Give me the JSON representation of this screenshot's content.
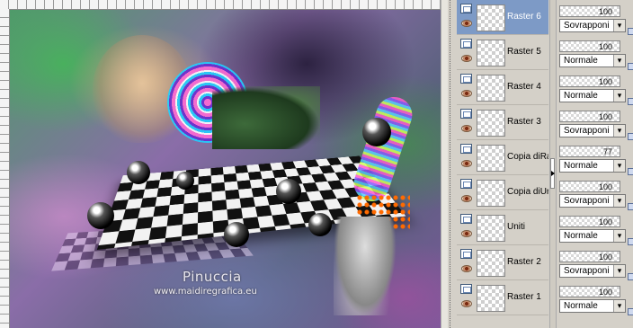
{
  "watermark": {
    "author": "Pinuccia",
    "site": "www.maidiregrafica.eu"
  },
  "layers": [
    {
      "name": "Raster 6",
      "selected": true
    },
    {
      "name": "Raster 5",
      "selected": false
    },
    {
      "name": "Raster 4",
      "selected": false
    },
    {
      "name": "Raster 3",
      "selected": false
    },
    {
      "name": "Copia diRa",
      "selected": false
    },
    {
      "name": "Copia diUr",
      "selected": false
    },
    {
      "name": "Uniti",
      "selected": false
    },
    {
      "name": "Raster 2",
      "selected": false
    },
    {
      "name": "Raster 1",
      "selected": false
    }
  ],
  "properties": [
    {
      "opacity": "100",
      "blend": "Sovrapponi"
    },
    {
      "opacity": "100",
      "blend": "Normale"
    },
    {
      "opacity": "100",
      "blend": "Normale"
    },
    {
      "opacity": "100",
      "blend": "Sovrapponi"
    },
    {
      "opacity": "77",
      "blend": "Normale"
    },
    {
      "opacity": "100",
      "blend": "Sovrapponi"
    },
    {
      "opacity": "100",
      "blend": "Normale"
    },
    {
      "opacity": "100",
      "blend": "Sovrapponi"
    },
    {
      "opacity": "100",
      "blend": "Normale"
    }
  ],
  "colors": {
    "selected_layer": "#7d9ac6",
    "panel_bg": "#d4d0c8"
  }
}
